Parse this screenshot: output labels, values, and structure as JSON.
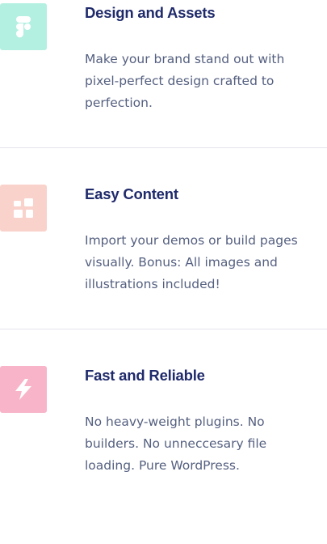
{
  "features": [
    {
      "title": "Design and Assets",
      "description": "Make your brand stand out with pixel-perfect design crafted to perfection.",
      "icon": "figma-icon",
      "tile_color": "#b4f0e1"
    },
    {
      "title": "Easy Content",
      "description": "Import your demos or build pages visually. Bonus: All images and illustrations included!",
      "icon": "grid-icon",
      "tile_color": "#fad2cc"
    },
    {
      "title": "Fast and Reliable",
      "description": "No heavy-weight plugins. No builders. No unneccesary file loading. Pure WordPress.",
      "icon": "lightning-icon",
      "tile_color": "#f8b4c8"
    }
  ]
}
